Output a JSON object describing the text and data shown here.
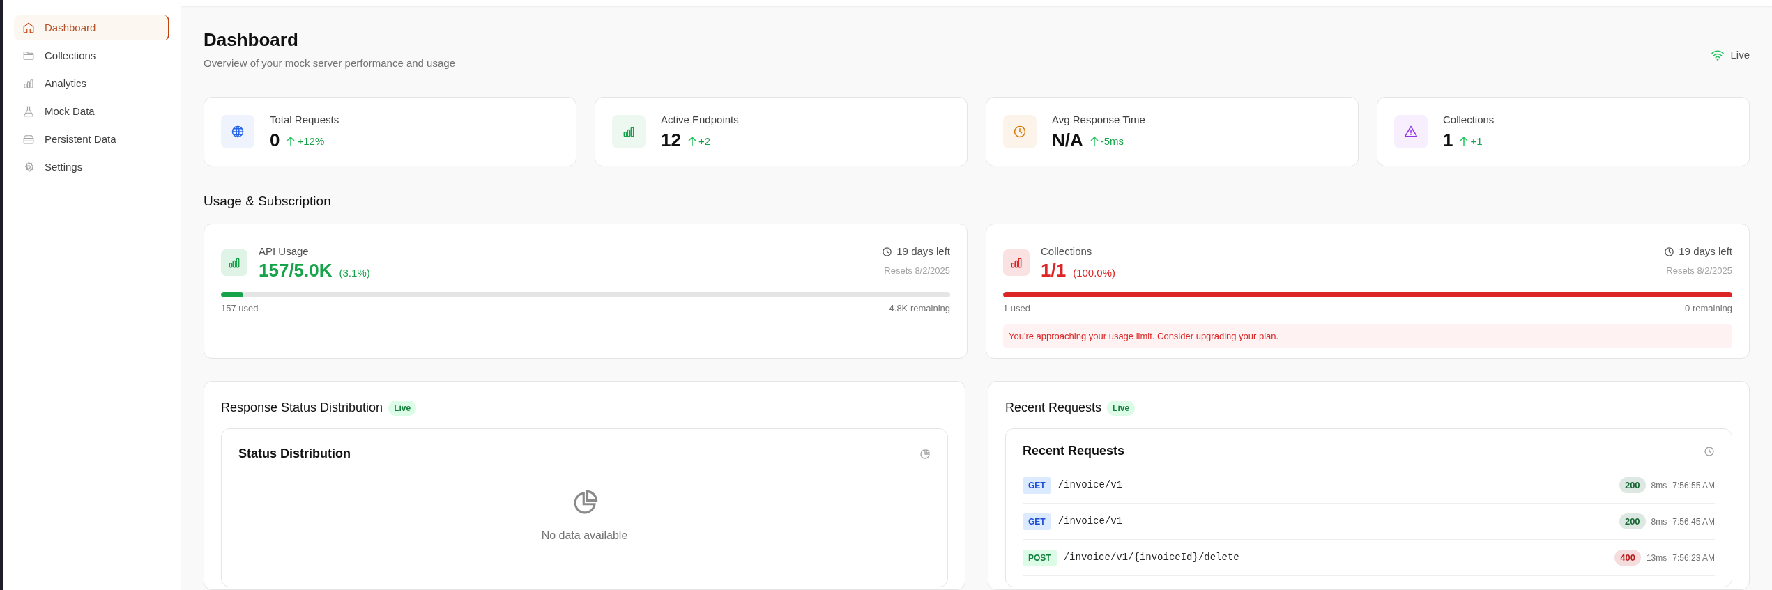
{
  "sidebar": {
    "items": [
      {
        "label": "Dashboard",
        "selected": true
      },
      {
        "label": "Collections",
        "selected": false
      },
      {
        "label": "Analytics",
        "selected": false
      },
      {
        "label": "Mock Data",
        "selected": false
      },
      {
        "label": "Persistent Data",
        "selected": false
      },
      {
        "label": "Settings",
        "selected": false
      }
    ]
  },
  "header": {
    "title": "Dashboard",
    "subtitle": "Overview of your mock server performance and usage",
    "live": "Live"
  },
  "stats": [
    {
      "label": "Total Requests",
      "value": "0",
      "change": "+12%",
      "color": "#2563eb"
    },
    {
      "label": "Active Endpoints",
      "value": "12",
      "change": "+2",
      "color": "#16a34a"
    },
    {
      "label": "Avg Response Time",
      "value": "N/A",
      "change": "-5ms",
      "color": "#d97706"
    },
    {
      "label": "Collections",
      "value": "1",
      "change": "+1",
      "color": "#9333ea"
    }
  ],
  "usage": {
    "title": "Usage & Subscription",
    "cards": [
      {
        "label": "API Usage",
        "value": "157/5.0K",
        "percent": "(3.1%)",
        "days_left": "19 days left",
        "resets": "Resets 8/2/2025",
        "level": 0.031,
        "used": "157 used",
        "remaining": "4.8K remaining",
        "color": "#16a34a"
      },
      {
        "label": "Collections",
        "value": "1/1",
        "percent": "(100.0%)",
        "days_left": "19 days left",
        "resets": "Resets 8/2/2025",
        "level": 1,
        "used": "1 used",
        "remaining": "0 remaining",
        "color": "#dc2626",
        "warning": "You're approaching your usage limit. Consider upgrading your plan."
      }
    ]
  },
  "status_panel": {
    "title": "Response Status Distribution",
    "badge": "Live",
    "card_title": "Status Distribution",
    "empty": "No data available"
  },
  "requests_panel": {
    "title": "Recent Requests",
    "badge": "Live",
    "card_title": "Recent Requests",
    "rows": [
      {
        "kind": "get",
        "method": "GET",
        "path": "/invoice/v1",
        "status": "200",
        "color": "#166534",
        "duration": "8ms",
        "time": "7:56:55 AM"
      },
      {
        "kind": "get",
        "method": "GET",
        "path": "/invoice/v1",
        "status": "200",
        "color": "#166534",
        "duration": "8ms",
        "time": "7:56:45 AM"
      },
      {
        "kind": "post",
        "method": "POST",
        "path": "/invoice/v1/{invoiceId}/delete",
        "status": "400",
        "color": "#b91c1c",
        "duration": "13ms",
        "time": "7:56:23 AM"
      }
    ]
  }
}
